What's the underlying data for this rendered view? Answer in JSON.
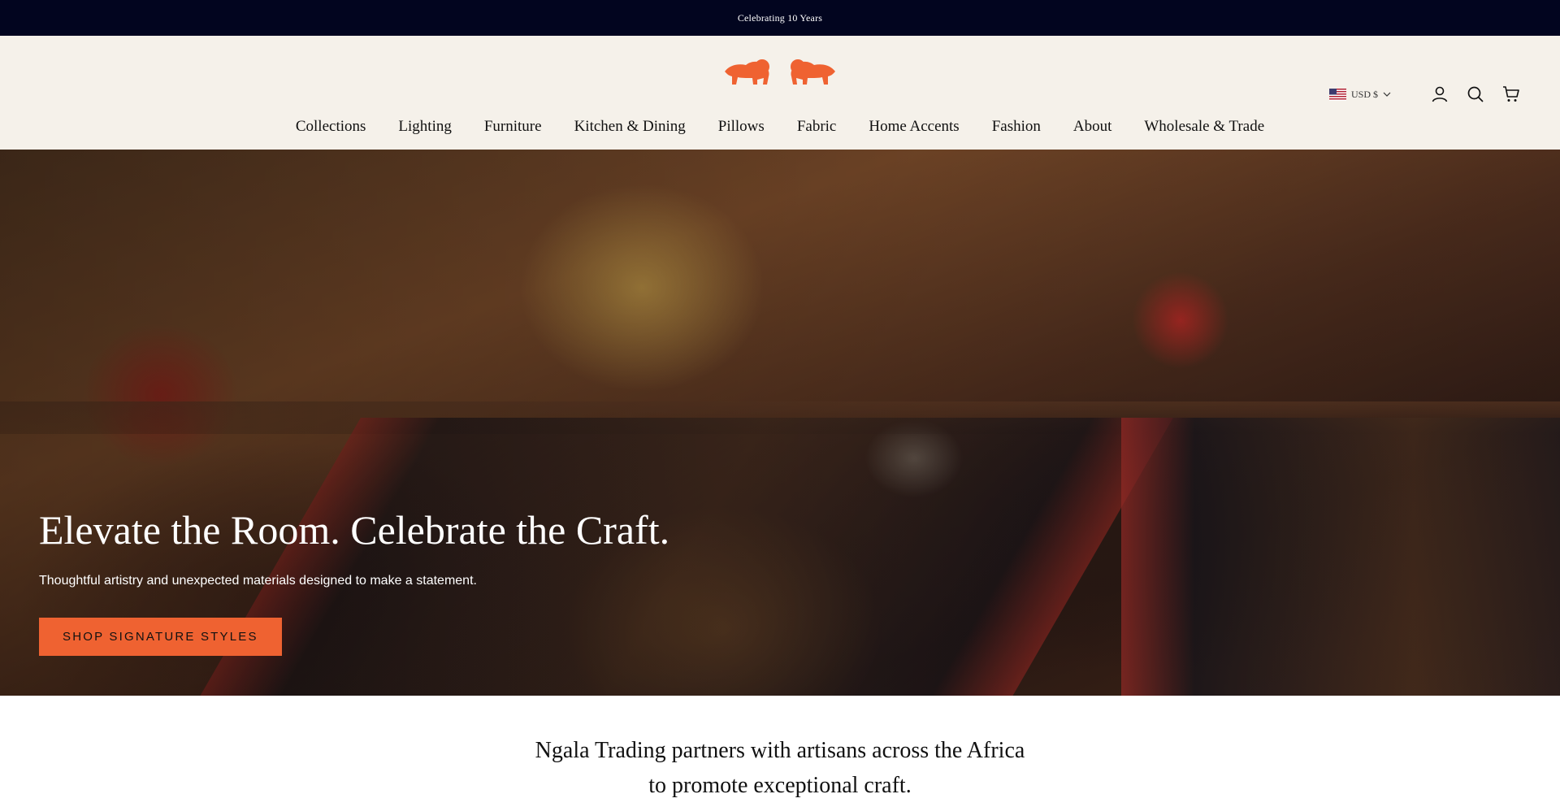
{
  "announcement": {
    "text": "Celebrating 10 Years"
  },
  "header": {
    "logo": {
      "name": "lion-logo",
      "color": "#ef6231"
    },
    "currency": {
      "label": "USD $",
      "flag": "us-flag-icon"
    },
    "icons": {
      "account": "account-icon",
      "search": "search-icon",
      "cart": "cart-icon"
    }
  },
  "nav": {
    "items": [
      {
        "label": "Collections"
      },
      {
        "label": "Lighting"
      },
      {
        "label": "Furniture"
      },
      {
        "label": "Kitchen & Dining"
      },
      {
        "label": "Pillows"
      },
      {
        "label": "Fabric"
      },
      {
        "label": "Home Accents"
      },
      {
        "label": "Fashion"
      },
      {
        "label": "About"
      },
      {
        "label": "Wholesale & Trade"
      }
    ]
  },
  "hero": {
    "title": "Elevate the Room. Celebrate the Craft.",
    "subtitle": "Thoughtful artistry and unexpected materials designed to make a statement.",
    "cta": "SHOP SIGNATURE STYLES"
  },
  "intro": {
    "text": "Ngala Trading partners with artisans across the Africa to promote exceptional craft."
  },
  "colors": {
    "announcement_bg": "#02051f",
    "header_bg": "#f5f1ea",
    "accent": "#ef6231"
  }
}
